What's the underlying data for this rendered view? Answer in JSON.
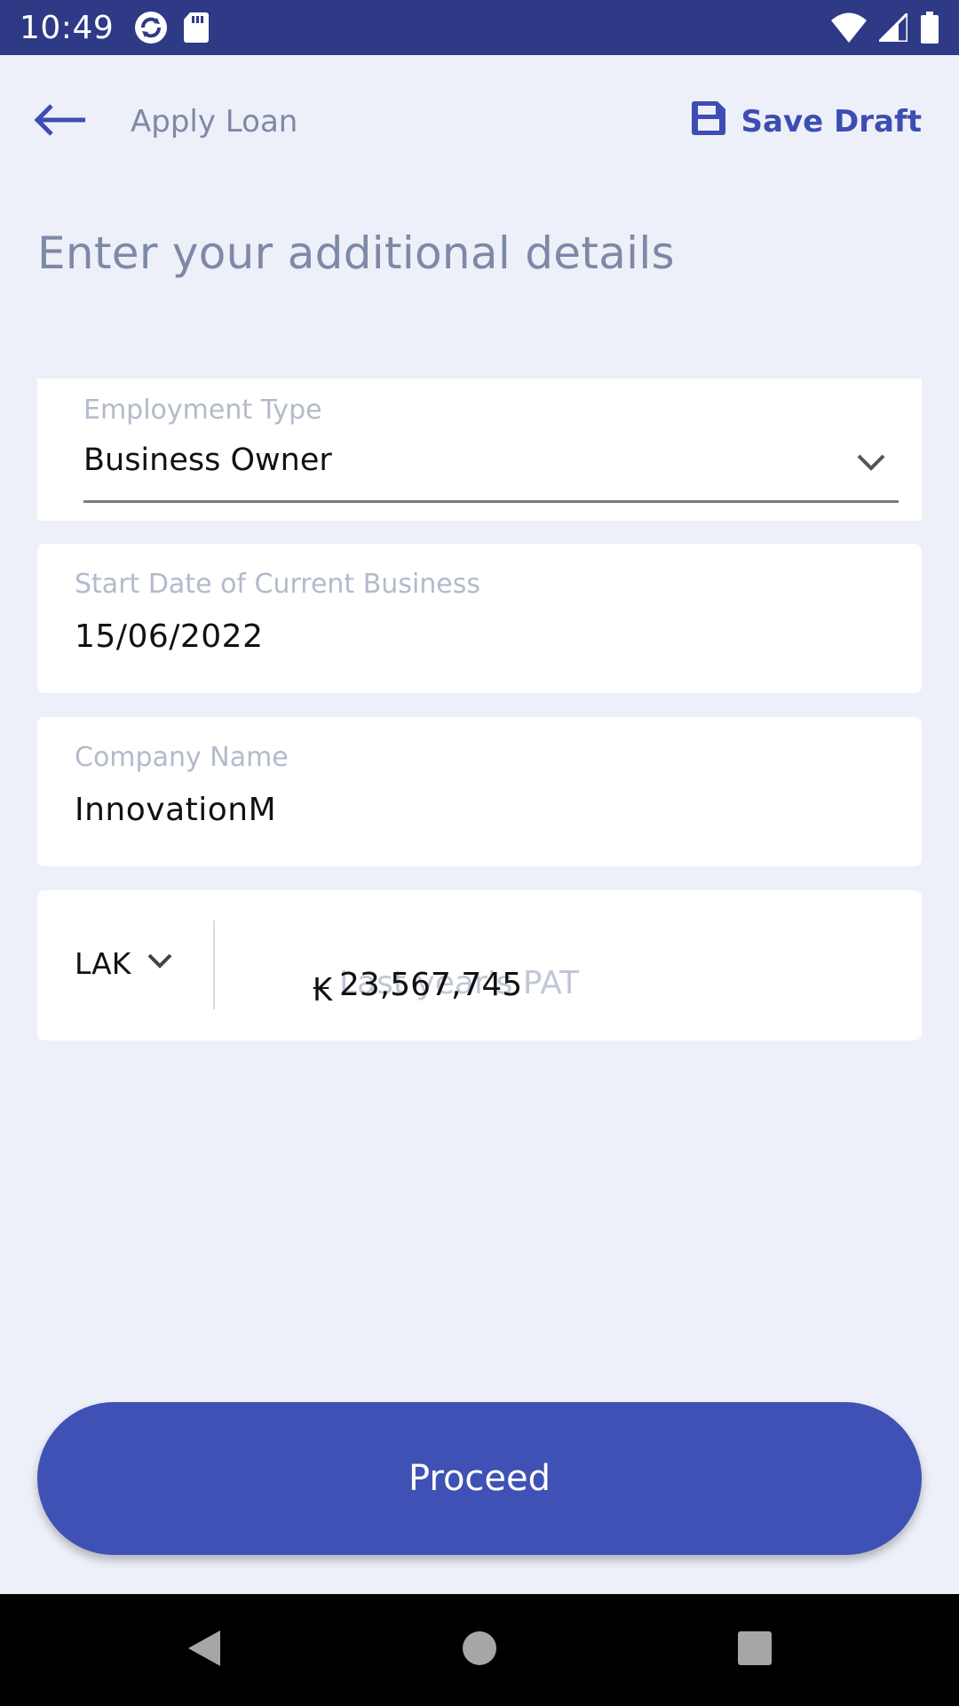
{
  "status_bar": {
    "time": "10:49",
    "left_icons": [
      "sync-app-icon",
      "sd-card-icon"
    ],
    "right_icons": [
      "wifi-icon",
      "cellular-signal-icon",
      "battery-icon"
    ]
  },
  "header": {
    "back_icon": "arrow-left-icon",
    "title": "Apply Loan",
    "save_icon": "floppy-disk-icon",
    "save_label": "Save Draft"
  },
  "page": {
    "heading": "Enter your additional details"
  },
  "form": {
    "employment_type": {
      "label": "Employment Type",
      "value": "Business Owner"
    },
    "start_date": {
      "label": "Start Date of Current Business",
      "value": "15/06/2022"
    },
    "company_name": {
      "label": "Company Name",
      "value": "InnovationM"
    },
    "last_year_pat": {
      "currency": "LAK",
      "label": "Last year's PAT",
      "symbol": "₭",
      "value": "23,567,745"
    }
  },
  "actions": {
    "proceed_label": "Proceed"
  },
  "colors": {
    "status_bar": "#2e3a85",
    "accent": "#4051b5",
    "background": "#edf0f8"
  }
}
